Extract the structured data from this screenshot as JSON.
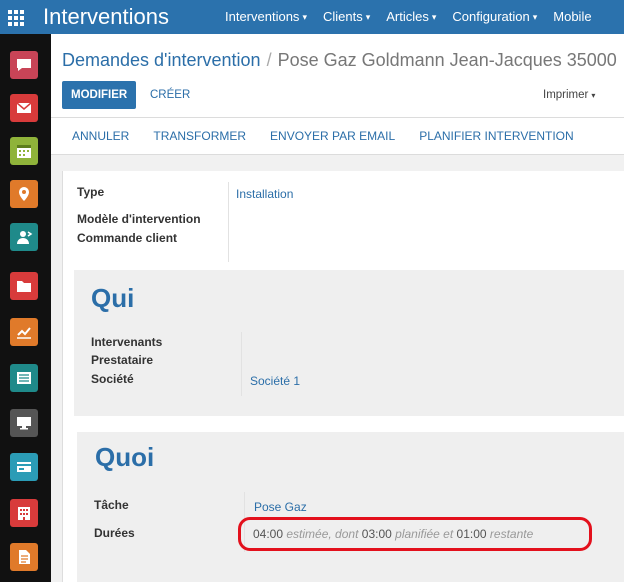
{
  "app": {
    "title": "Interventions",
    "menu": [
      {
        "label": "Interventions",
        "caret": "▾"
      },
      {
        "label": "Clients",
        "caret": "▾"
      },
      {
        "label": "Articles",
        "caret": "▾"
      },
      {
        "label": "Configuration",
        "caret": "▾"
      },
      {
        "label": "Mobile",
        "caret": ""
      }
    ]
  },
  "sidebar": {
    "items": [
      {
        "icon": "chat-icon",
        "color": "#c84457"
      },
      {
        "icon": "mail-icon",
        "color": "#d83b3b"
      },
      {
        "icon": "calendar-icon",
        "color": "#8fb33a"
      },
      {
        "icon": "map-pin-icon",
        "color": "#e07a2a"
      },
      {
        "icon": "contacts-icon",
        "color": "#1f8a8a"
      },
      {
        "icon": "folder-icon",
        "color": "#d83b3b"
      },
      {
        "icon": "chart-icon",
        "color": "#e07a2a"
      },
      {
        "icon": "newspaper-icon",
        "color": "#1f8a8a"
      },
      {
        "icon": "monitor-icon",
        "color": "#555555"
      },
      {
        "icon": "card-icon",
        "color": "#2b9cb6"
      },
      {
        "icon": "building-icon",
        "color": "#d83b3b"
      },
      {
        "icon": "document-icon",
        "color": "#e07a2a"
      }
    ]
  },
  "breadcrumb": {
    "parent": "Demandes d'intervention",
    "separator": "/",
    "current": "Pose Gaz Goldmann Jean-Jacques 35000"
  },
  "buttons": {
    "edit": "MODIFIER",
    "create": "CRÉER",
    "print": "Imprimer",
    "print_caret": "▾"
  },
  "status_buttons": [
    "ANNULER",
    "TRANSFORMER",
    "ENVOYER PAR EMAIL",
    "PLANIFIER INTERVENTION"
  ],
  "header_fields": {
    "type_label": "Type",
    "type_value": "Installation",
    "model_label": "Modèle d'intervention",
    "order_label": "Commande client"
  },
  "qui": {
    "title": "Qui",
    "intervenants_label": "Intervenants",
    "prestataire_label": "Prestataire",
    "societe_label": "Société",
    "societe_value": "Société 1"
  },
  "quoi": {
    "title": "Quoi",
    "tache_label": "Tâche",
    "tache_value": "Pose Gaz",
    "durees_label": "Durées",
    "durees": {
      "estimated": "04:00",
      "estimated_text": "estimée, dont",
      "planned": "03:00",
      "planned_text": "planifiée et",
      "remaining": "01:00",
      "remaining_text": "restante"
    }
  },
  "colors": {
    "brand": "#2b72ad",
    "link": "#2b6ea8",
    "highlight": "#e3101c"
  }
}
